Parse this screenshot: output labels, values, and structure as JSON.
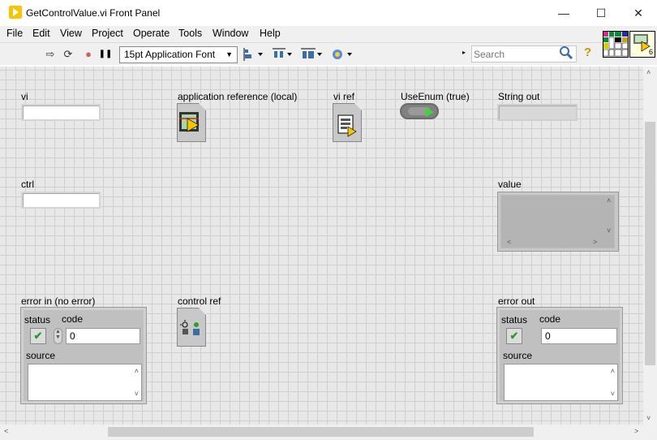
{
  "window": {
    "title": "GetControlValue.vi Front Panel",
    "minimize_glyph": "—",
    "maximize_glyph": "☐",
    "close_glyph": "✕"
  },
  "menu": [
    "File",
    "Edit",
    "View",
    "Project",
    "Operate",
    "Tools",
    "Window",
    "Help"
  ],
  "toolbar": {
    "font": "15pt Application Font",
    "search_placeholder": "Search",
    "run_glyph": "⇨",
    "run_cont_glyph": "⟳",
    "abort_glyph": "●",
    "pause_glyph": "❚❚",
    "help_glyph": "?"
  },
  "vi_icon_badge": "6",
  "panel": {
    "vi_label": "vi",
    "ctrl_label": "ctrl",
    "app_ref_label": "application reference (local)",
    "vi_ref_label": "vi ref",
    "use_enum_label": "UseEnum (true)",
    "string_out_label": "String out",
    "value_label": "value",
    "control_ref_label": "control ref",
    "error_in": {
      "title": "error in (no error)",
      "status_label": "status",
      "code_label": "code",
      "code_value": "0",
      "source_label": "source",
      "status_glyph": "✔"
    },
    "error_out": {
      "title": "error out",
      "status_label": "status",
      "code_label": "code",
      "code_value": "0",
      "source_label": "source",
      "status_glyph": "✔"
    }
  },
  "colors": {
    "canvas": "#e8e8e8",
    "grid": "#cfcfcf",
    "led_arrow": "#3fd43f",
    "status_check": "#2a9a2a"
  }
}
